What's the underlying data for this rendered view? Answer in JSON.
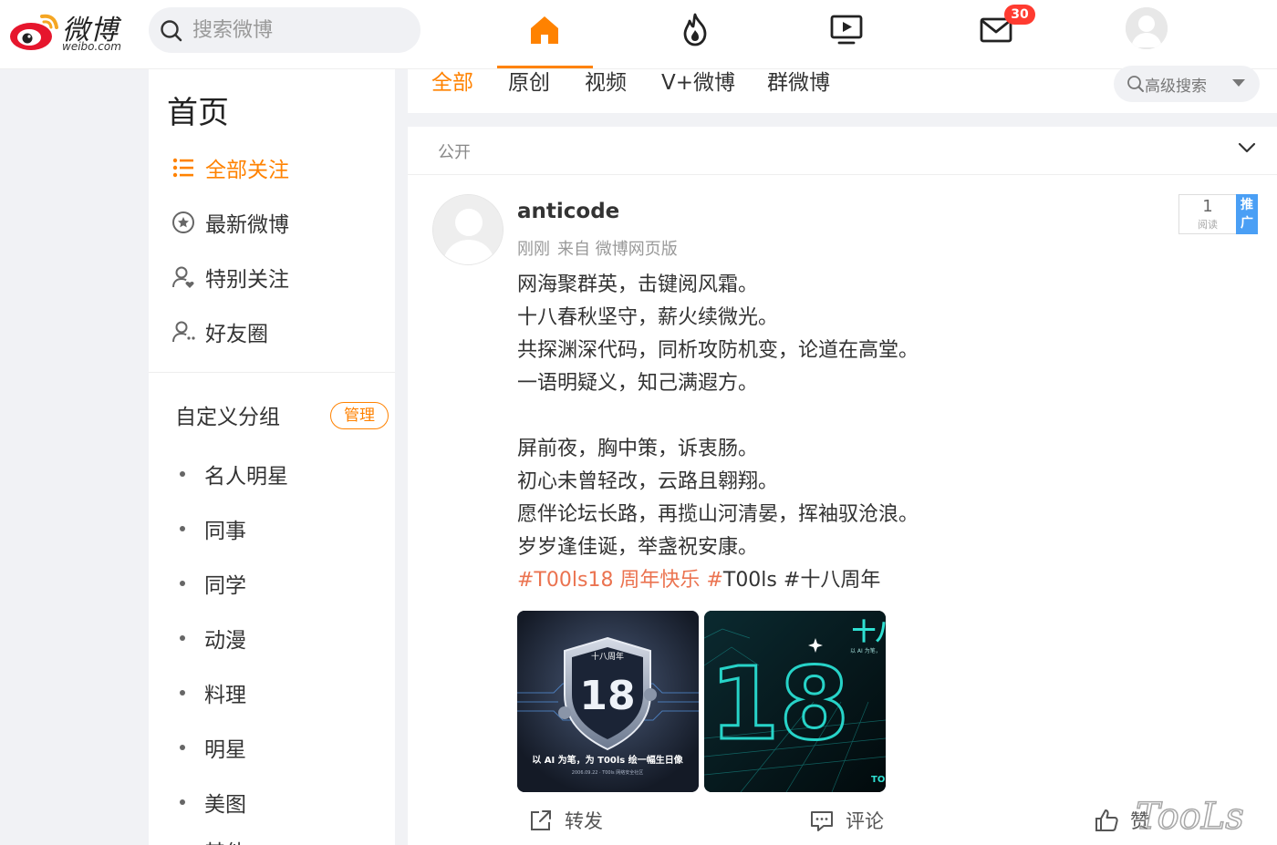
{
  "logo": {
    "brand": "微博",
    "domain": "weibo.com"
  },
  "search": {
    "placeholder": "搜索微博"
  },
  "topnav": {
    "items": [
      {
        "name": "home",
        "icon": "home-icon"
      },
      {
        "name": "hot",
        "icon": "flame-icon"
      },
      {
        "name": "video",
        "icon": "video-play-icon"
      },
      {
        "name": "messages",
        "icon": "mail-icon",
        "badge": "30"
      },
      {
        "name": "profile",
        "icon": "avatar"
      }
    ]
  },
  "sidebar": {
    "title": "首页",
    "items": [
      {
        "label": "全部关注",
        "icon": "list-icon",
        "active": true
      },
      {
        "label": "最新微博",
        "icon": "star-circle-icon"
      },
      {
        "label": "特别关注",
        "icon": "user-heart-icon"
      },
      {
        "label": "好友圈",
        "icon": "user-friends-icon"
      }
    ],
    "group_title": "自定义分组",
    "manage_label": "管理",
    "groups": [
      "名人明星",
      "同事",
      "同学",
      "动漫",
      "料理",
      "明星",
      "美图",
      "其他"
    ]
  },
  "tabs": {
    "items": [
      "全部",
      "原创",
      "视频",
      "V+微博",
      "群微博"
    ],
    "active_index": 0,
    "advanced_search": "高级搜索"
  },
  "feed": {
    "visibility": "公开",
    "post": {
      "user": "anticode",
      "time": "刚刚",
      "source": "来自 微博网页版",
      "reads": "1",
      "reads_label": "阅读",
      "promo_label": "推广",
      "lines": [
        "网海聚群英，击键阅风霜。",
        "十八春秋坚守，薪火续微光。",
        "共探渊深代码，同析攻防机变，论道在高堂。",
        "一语明疑义，知己满遐方。",
        "",
        "屏前夜，胸中策，诉衷肠。",
        "初心未曾轻改，云路且翱翔。",
        "愿伴论坛长路，再揽山河清晏，挥袖驭沧浪。",
        "岁岁逢佳诞，举盏祝安康。"
      ],
      "tags": {
        "tag1": "#T00ls18 周年快乐",
        "tag2_prefix": "#",
        "tag2_rest": "T00ls",
        "tag3": "#十八周年"
      },
      "images": [
        {
          "badge_top": "十八周年",
          "number": "18",
          "caption": "以 AI 为笔，为 T00ls 绘一幅生日像",
          "subcaption": "2006.09.22 · T00ls 网络安全社区"
        },
        {
          "heading": "十八",
          "subheading": "以 AI 为笔，",
          "number": "18",
          "corner": "TO"
        }
      ],
      "actions": {
        "repost": "转发",
        "comment": "评论",
        "like": "赞"
      }
    }
  },
  "watermark": {
    "text": "TooLs"
  },
  "colors": {
    "accent": "#ff8200",
    "tag": "#eb7350",
    "badge": "#ff3b30",
    "promo": "#4a9ff5"
  }
}
